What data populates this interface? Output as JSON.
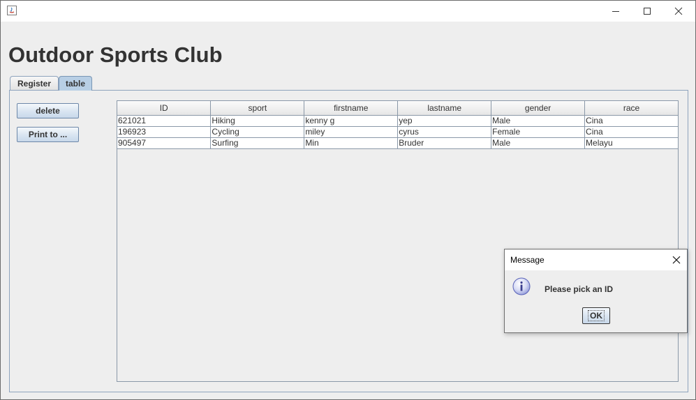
{
  "window": {
    "title": "",
    "controls": [
      "minimize-icon",
      "maximize-icon",
      "close-icon"
    ]
  },
  "app": {
    "heading": "Outdoor Sports Club"
  },
  "tabs": [
    {
      "label": "Register",
      "selected": false
    },
    {
      "label": "table",
      "selected": true
    }
  ],
  "sidebar": {
    "delete_label": "delete",
    "print_label": "Print to ..."
  },
  "table": {
    "columns": [
      "ID",
      "sport",
      "firstname",
      "lastname",
      "gender",
      "race"
    ],
    "rows": [
      [
        "621021",
        "Hiking",
        "kenny g",
        "yep",
        "Male",
        "Cina"
      ],
      [
        "196923",
        "Cycling",
        "miley",
        "cyrus",
        "Female",
        "Cina"
      ],
      [
        "905497",
        "Surfing",
        "Min",
        "Bruder",
        "Male",
        "Melayu"
      ]
    ]
  },
  "dialog": {
    "title": "Message",
    "icon": "info-icon",
    "message": "Please pick an ID",
    "ok_label": "OK"
  },
  "colors": {
    "selected_tab": "#b8cfe5",
    "background": "#eeeeee",
    "border": "#8ea3bd"
  }
}
